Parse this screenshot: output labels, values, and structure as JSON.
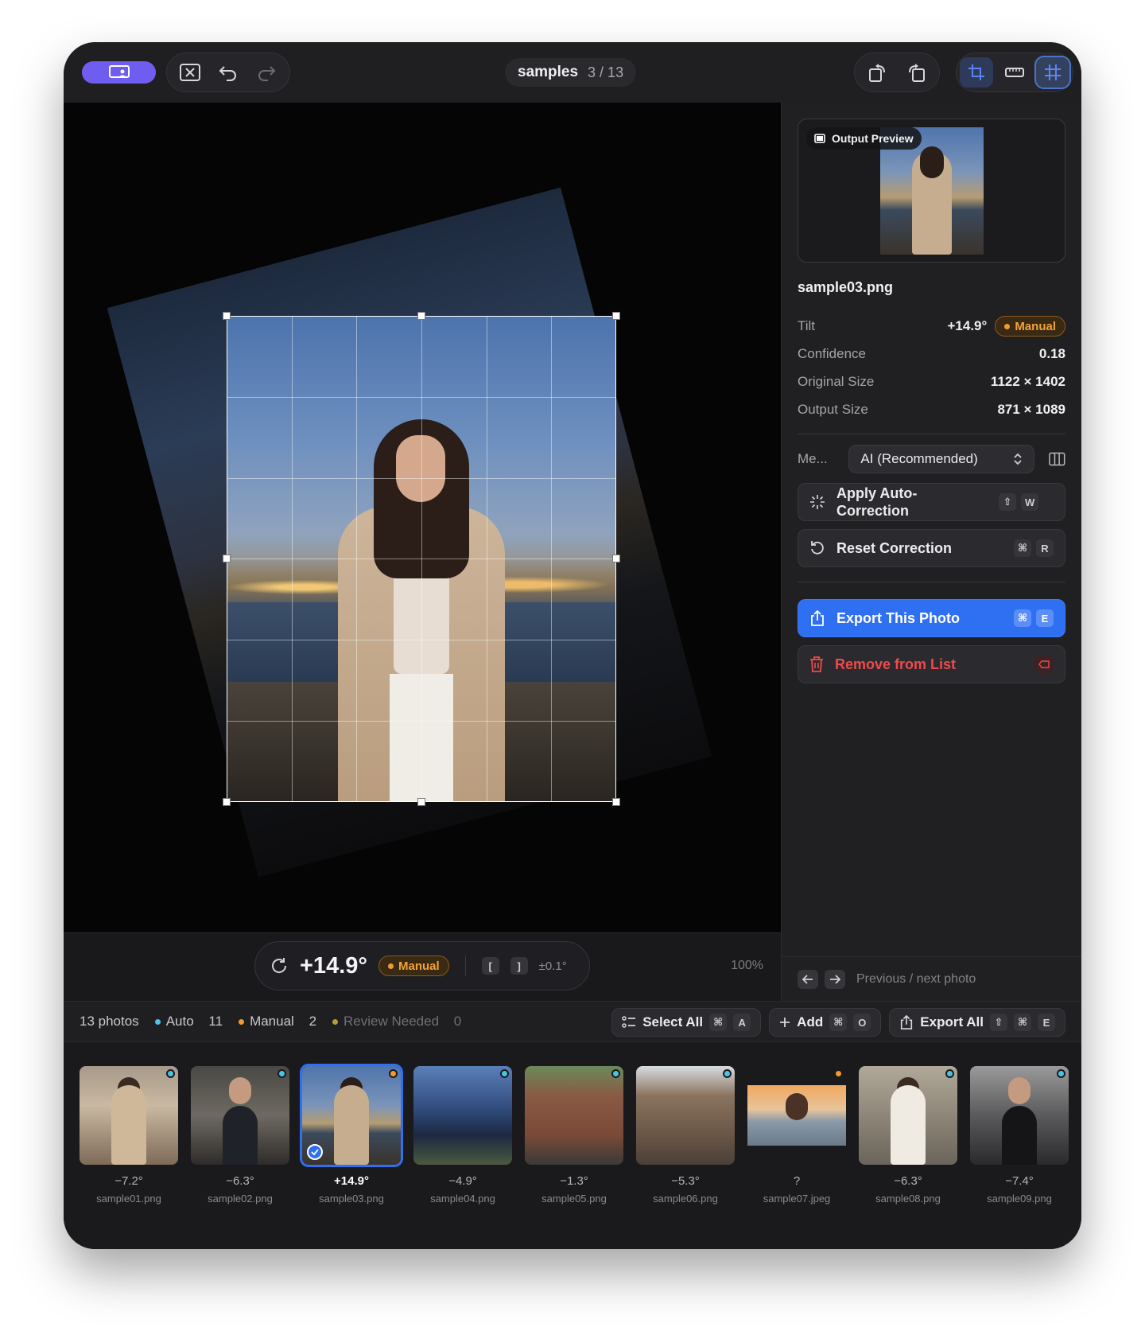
{
  "titlebar": {
    "doc_name": "samples",
    "doc_position": "3 / 13"
  },
  "colors": {
    "accent": "#6f5df0",
    "primary": "#2f6ff2",
    "auto_dot": "#4cc3e6",
    "manual_dot": "#f29a2e",
    "review_dot": "#b79a3a",
    "danger": "#ef4a4a"
  },
  "canvas": {
    "angle": "+14.9°",
    "mode_badge": "Manual",
    "step_keys": [
      "[",
      "]"
    ],
    "step_label": "±0.1°",
    "zoom": "100%"
  },
  "panel": {
    "preview_label": "Output Preview",
    "file_name": "sample03.png",
    "info": [
      {
        "key": "Tilt",
        "value": "+14.9°",
        "badge": "Manual"
      },
      {
        "key": "Confidence",
        "value": "0.18"
      },
      {
        "key": "Original Size",
        "value": "1122 × 1402"
      },
      {
        "key": "Output Size",
        "value": "871 × 1089"
      }
    ],
    "method_label": "Me...",
    "method_value": "AI (Recommended)",
    "actions": {
      "auto_correct": {
        "label": "Apply Auto-Correction",
        "keys": [
          "⇧",
          "W"
        ]
      },
      "reset": {
        "label": "Reset Correction",
        "keys": [
          "⌘",
          "R"
        ]
      },
      "export": {
        "label": "Export This Photo",
        "keys": [
          "⌘",
          "E"
        ]
      },
      "remove": {
        "label": "Remove from List"
      }
    },
    "nav_hint": "Previous / next photo"
  },
  "stats": {
    "photos": "13 photos",
    "auto_label": "Auto",
    "auto_count": "11",
    "manual_label": "Manual",
    "manual_count": "2",
    "review_label": "Review Needed",
    "review_count": "0",
    "select_all": {
      "label": "Select All",
      "keys": [
        "⌘",
        "A"
      ]
    },
    "add": {
      "label": "Add",
      "keys": [
        "⌘",
        "O"
      ]
    },
    "export_all": {
      "label": "Export All",
      "keys": [
        "⇧",
        "⌘",
        "E"
      ]
    }
  },
  "filmstrip": [
    {
      "angle": "−7.2°",
      "file": "sample01.png",
      "status": "auto"
    },
    {
      "angle": "−6.3°",
      "file": "sample02.png",
      "status": "auto"
    },
    {
      "angle": "+14.9°",
      "file": "sample03.png",
      "status": "manual",
      "selected": true
    },
    {
      "angle": "−4.9°",
      "file": "sample04.png",
      "status": "auto"
    },
    {
      "angle": "−1.3°",
      "file": "sample05.png",
      "status": "auto"
    },
    {
      "angle": "−5.3°",
      "file": "sample06.png",
      "status": "auto"
    },
    {
      "angle": "?",
      "file": "sample07.jpeg",
      "status": "manual"
    },
    {
      "angle": "−6.3°",
      "file": "sample08.png",
      "status": "auto"
    },
    {
      "angle": "−7.4°",
      "file": "sample09.png",
      "status": "auto"
    }
  ]
}
